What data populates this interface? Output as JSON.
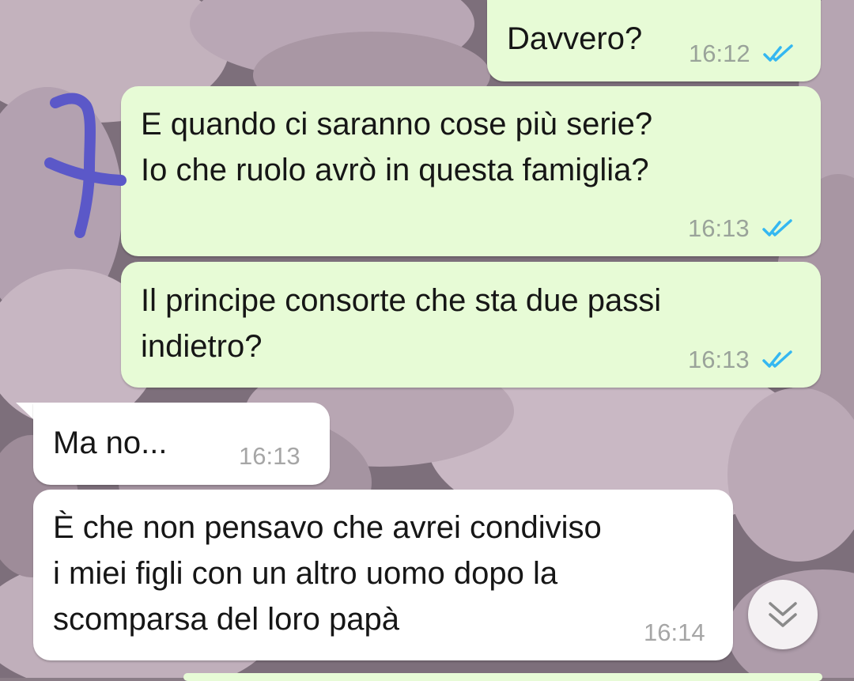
{
  "messages": [
    {
      "direction": "out",
      "text": "Davvero?",
      "time": "16:12",
      "status": "read"
    },
    {
      "direction": "out",
      "text_lines": [
        "E quando ci saranno cose più serie?",
        "Io che ruolo avrò in questa famiglia?"
      ],
      "time": "16:13",
      "status": "read"
    },
    {
      "direction": "out",
      "text_lines": [
        "Il principe consorte che sta due passi",
        "indietro?"
      ],
      "time": "16:13",
      "status": "read"
    },
    {
      "direction": "in",
      "text": "Ma no...",
      "time": "16:13"
    },
    {
      "direction": "in",
      "text_lines": [
        "È che non pensavo che avrei condiviso",
        "i miei figli con un altro uomo dopo la",
        "scomparsa del loro papà"
      ],
      "time": "16:14"
    }
  ],
  "colors": {
    "outgoing_bubble": "#e7fbd6",
    "incoming_bubble": "#ffffff",
    "read_ticks": "#34b7f1",
    "annotation_mark": "#5b58c8"
  },
  "icons": {
    "read_receipt": "double-check-icon",
    "scroll_down": "chevron-double-down-icon",
    "annotation": "hand-drawn-bracket-icon"
  }
}
